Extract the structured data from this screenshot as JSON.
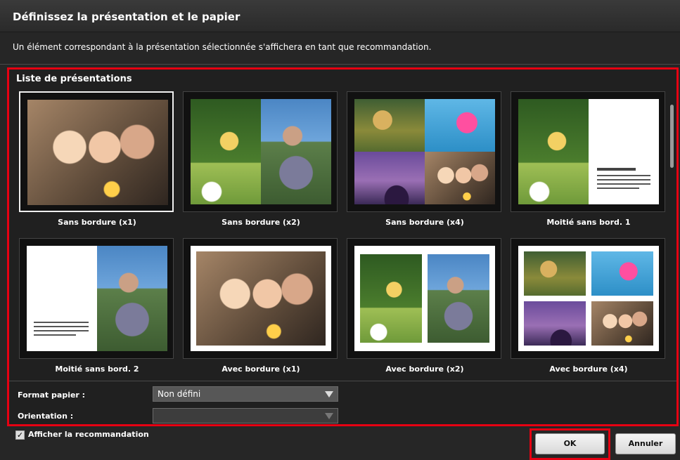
{
  "dialog": {
    "title": "Définissez la présentation et le papier",
    "subtitle": "Un élément correspondant à la présentation sélectionnée s'affichera en tant que recommandation."
  },
  "layouts": {
    "heading": "Liste de présentations",
    "items": [
      {
        "label": "Sans bordure (x1)",
        "selected": true
      },
      {
        "label": "Sans bordure (x2)",
        "selected": false
      },
      {
        "label": "Sans bordure (x4)",
        "selected": false
      },
      {
        "label": "Moitié sans bord. 1",
        "selected": false
      },
      {
        "label": "Moitié sans bord. 2",
        "selected": false
      },
      {
        "label": "Avec bordure (x1)",
        "selected": false
      },
      {
        "label": "Avec bordure (x2)",
        "selected": false
      },
      {
        "label": "Avec bordure (x4)",
        "selected": false
      }
    ]
  },
  "fields": {
    "paper_format_label": "Format papier :",
    "paper_format_value": "Non défini",
    "orientation_label": "Orientation :",
    "orientation_value": ""
  },
  "footer": {
    "show_recommendation_label": "Afficher la recommandation",
    "show_recommendation_checked": true,
    "ok_label": "OK",
    "cancel_label": "Annuler"
  },
  "colors": {
    "highlight": "#e60012"
  }
}
